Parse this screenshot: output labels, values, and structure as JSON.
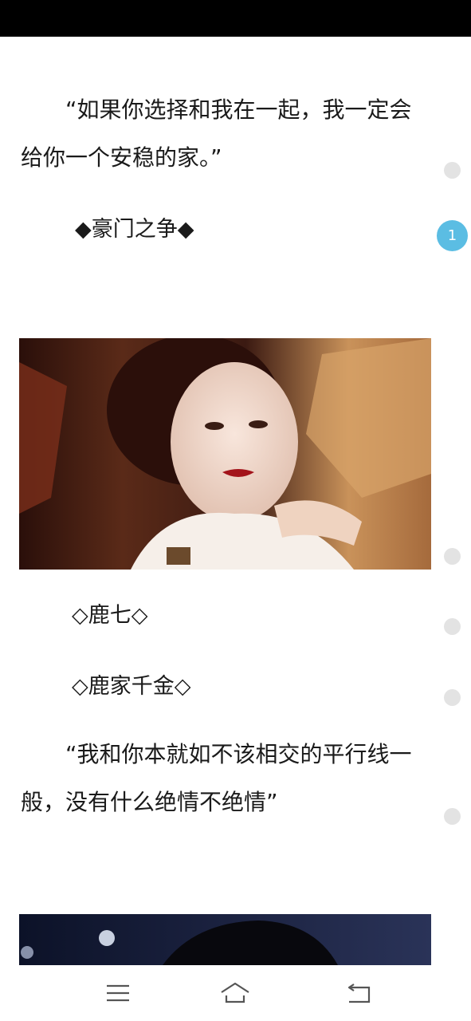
{
  "article": {
    "quote1": "“如果你选择和我在一起，我一定会给你一个安稳的家。”",
    "section_heading": "◆豪门之争◆",
    "name_line": "◇鹿七◇",
    "identity_line": "◇鹿家千金◇",
    "quote2": "“我和你本就如不该相交的平行线一般，没有什么绝情不绝情”"
  },
  "side_index": {
    "active_label": "1"
  },
  "nav": {
    "menu_icon": "menu-icon",
    "home_icon": "home-icon",
    "back_icon": "back-icon"
  },
  "colors": {
    "accent": "#5bbde3",
    "text": "#1a1a1a",
    "status_bar": "#000000"
  }
}
